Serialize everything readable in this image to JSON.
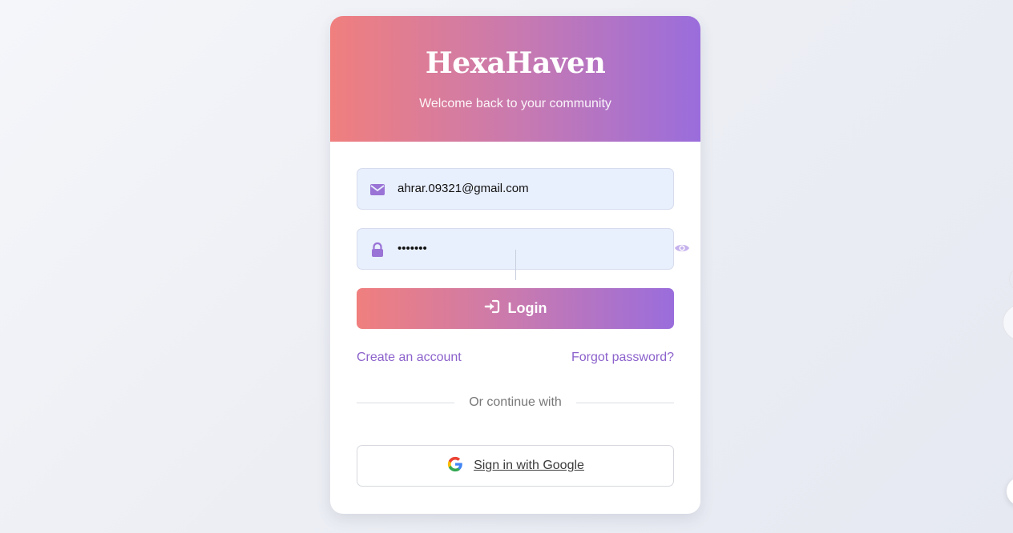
{
  "brand": {
    "title": "HexaHaven",
    "tagline": "Welcome back to your community"
  },
  "form": {
    "email": {
      "value": "ahrar.09321@gmail.com",
      "icon": "envelope-icon"
    },
    "password": {
      "value": "•••••••",
      "icon": "lock-icon",
      "toggle_icon": "eye-icon"
    },
    "login_button": {
      "label": "Login",
      "icon": "sign-in-icon"
    },
    "create_account_link": "Create an account",
    "forgot_password_link": "Forgot password?",
    "divider_text": "Or continue with",
    "google_button": {
      "label": "Sign in with Google",
      "icon": "google-icon"
    }
  },
  "colors": {
    "gradient_start": "#f07f7e",
    "gradient_mid": "#c97aaf",
    "gradient_end": "#9a6ddc",
    "link": "#8c62cc",
    "field_bg": "#e8effd"
  }
}
